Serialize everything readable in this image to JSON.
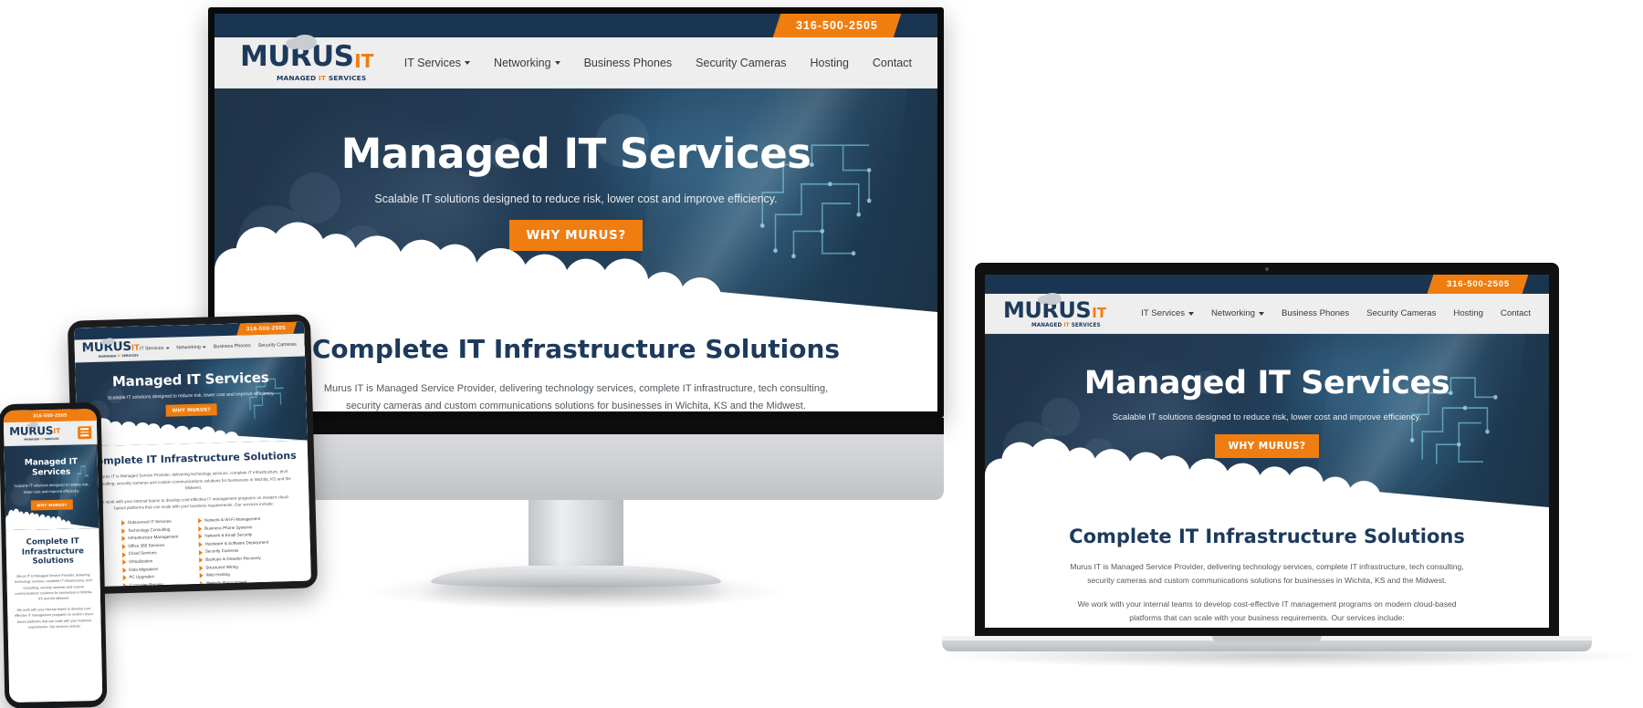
{
  "brand": {
    "logo_main": "MURUS",
    "logo_accent": "IT",
    "tagline_pre": "MANAGED ",
    "tagline_accent": "IT",
    "tagline_post": " SERVICES",
    "colors": {
      "navy": "#1d3a5c",
      "topbar_navy": "#1a3551",
      "orange": "#f07d10",
      "navbar_bg": "#eeeeee",
      "hero_dark": "#1f3449",
      "body_text": "#50585f"
    }
  },
  "topbar": {
    "phone": "316-500-2505"
  },
  "nav": {
    "items": [
      {
        "label": "IT Services",
        "has_dropdown": true
      },
      {
        "label": "Networking",
        "has_dropdown": true
      },
      {
        "label": "Business Phones",
        "has_dropdown": false
      },
      {
        "label": "Security Cameras",
        "has_dropdown": false
      },
      {
        "label": "Hosting",
        "has_dropdown": false
      },
      {
        "label": "Contact",
        "has_dropdown": false
      }
    ],
    "mobile_menu_icon": "hamburger-icon"
  },
  "hero": {
    "title": "Managed IT Services",
    "subtitle": "Scalable IT solutions designed to reduce risk, lower cost and improve efficiency.",
    "cta_label": "WHY MURUS?"
  },
  "section": {
    "title": "Complete IT Infrastructure Solutions",
    "paragraph_1": "Murus IT is Managed Service Provider, delivering technology services, complete IT infrastructure, tech consulting, security cameras and custom communications solutions for businesses in Wichita, KS and the Midwest.",
    "paragraph_2": "We work with your internal teams to develop cost-effective IT management programs on modern cloud-based platforms that can scale with your business requirements. Our services include:",
    "services_left": [
      "Outsourced IT Services",
      "Technology Consulting",
      "Infrastructure Management",
      "Office 365 Services",
      "Cloud Services",
      "Virtualization",
      "Data Migrations",
      "PC Upgrades",
      "Computer Repairs"
    ],
    "services_right": [
      "Network & Wi-Fi Management",
      "Business Phone Systems",
      "Network & Email Security",
      "Hardware & Software Deployment",
      "Security Cameras",
      "Backups & Disaster Recovery",
      "Structured Wiring",
      "Web Hosting",
      "Website Management"
    ]
  },
  "devices": [
    {
      "name": "desktop-monitor"
    },
    {
      "name": "laptop"
    },
    {
      "name": "tablet"
    },
    {
      "name": "phone"
    }
  ]
}
